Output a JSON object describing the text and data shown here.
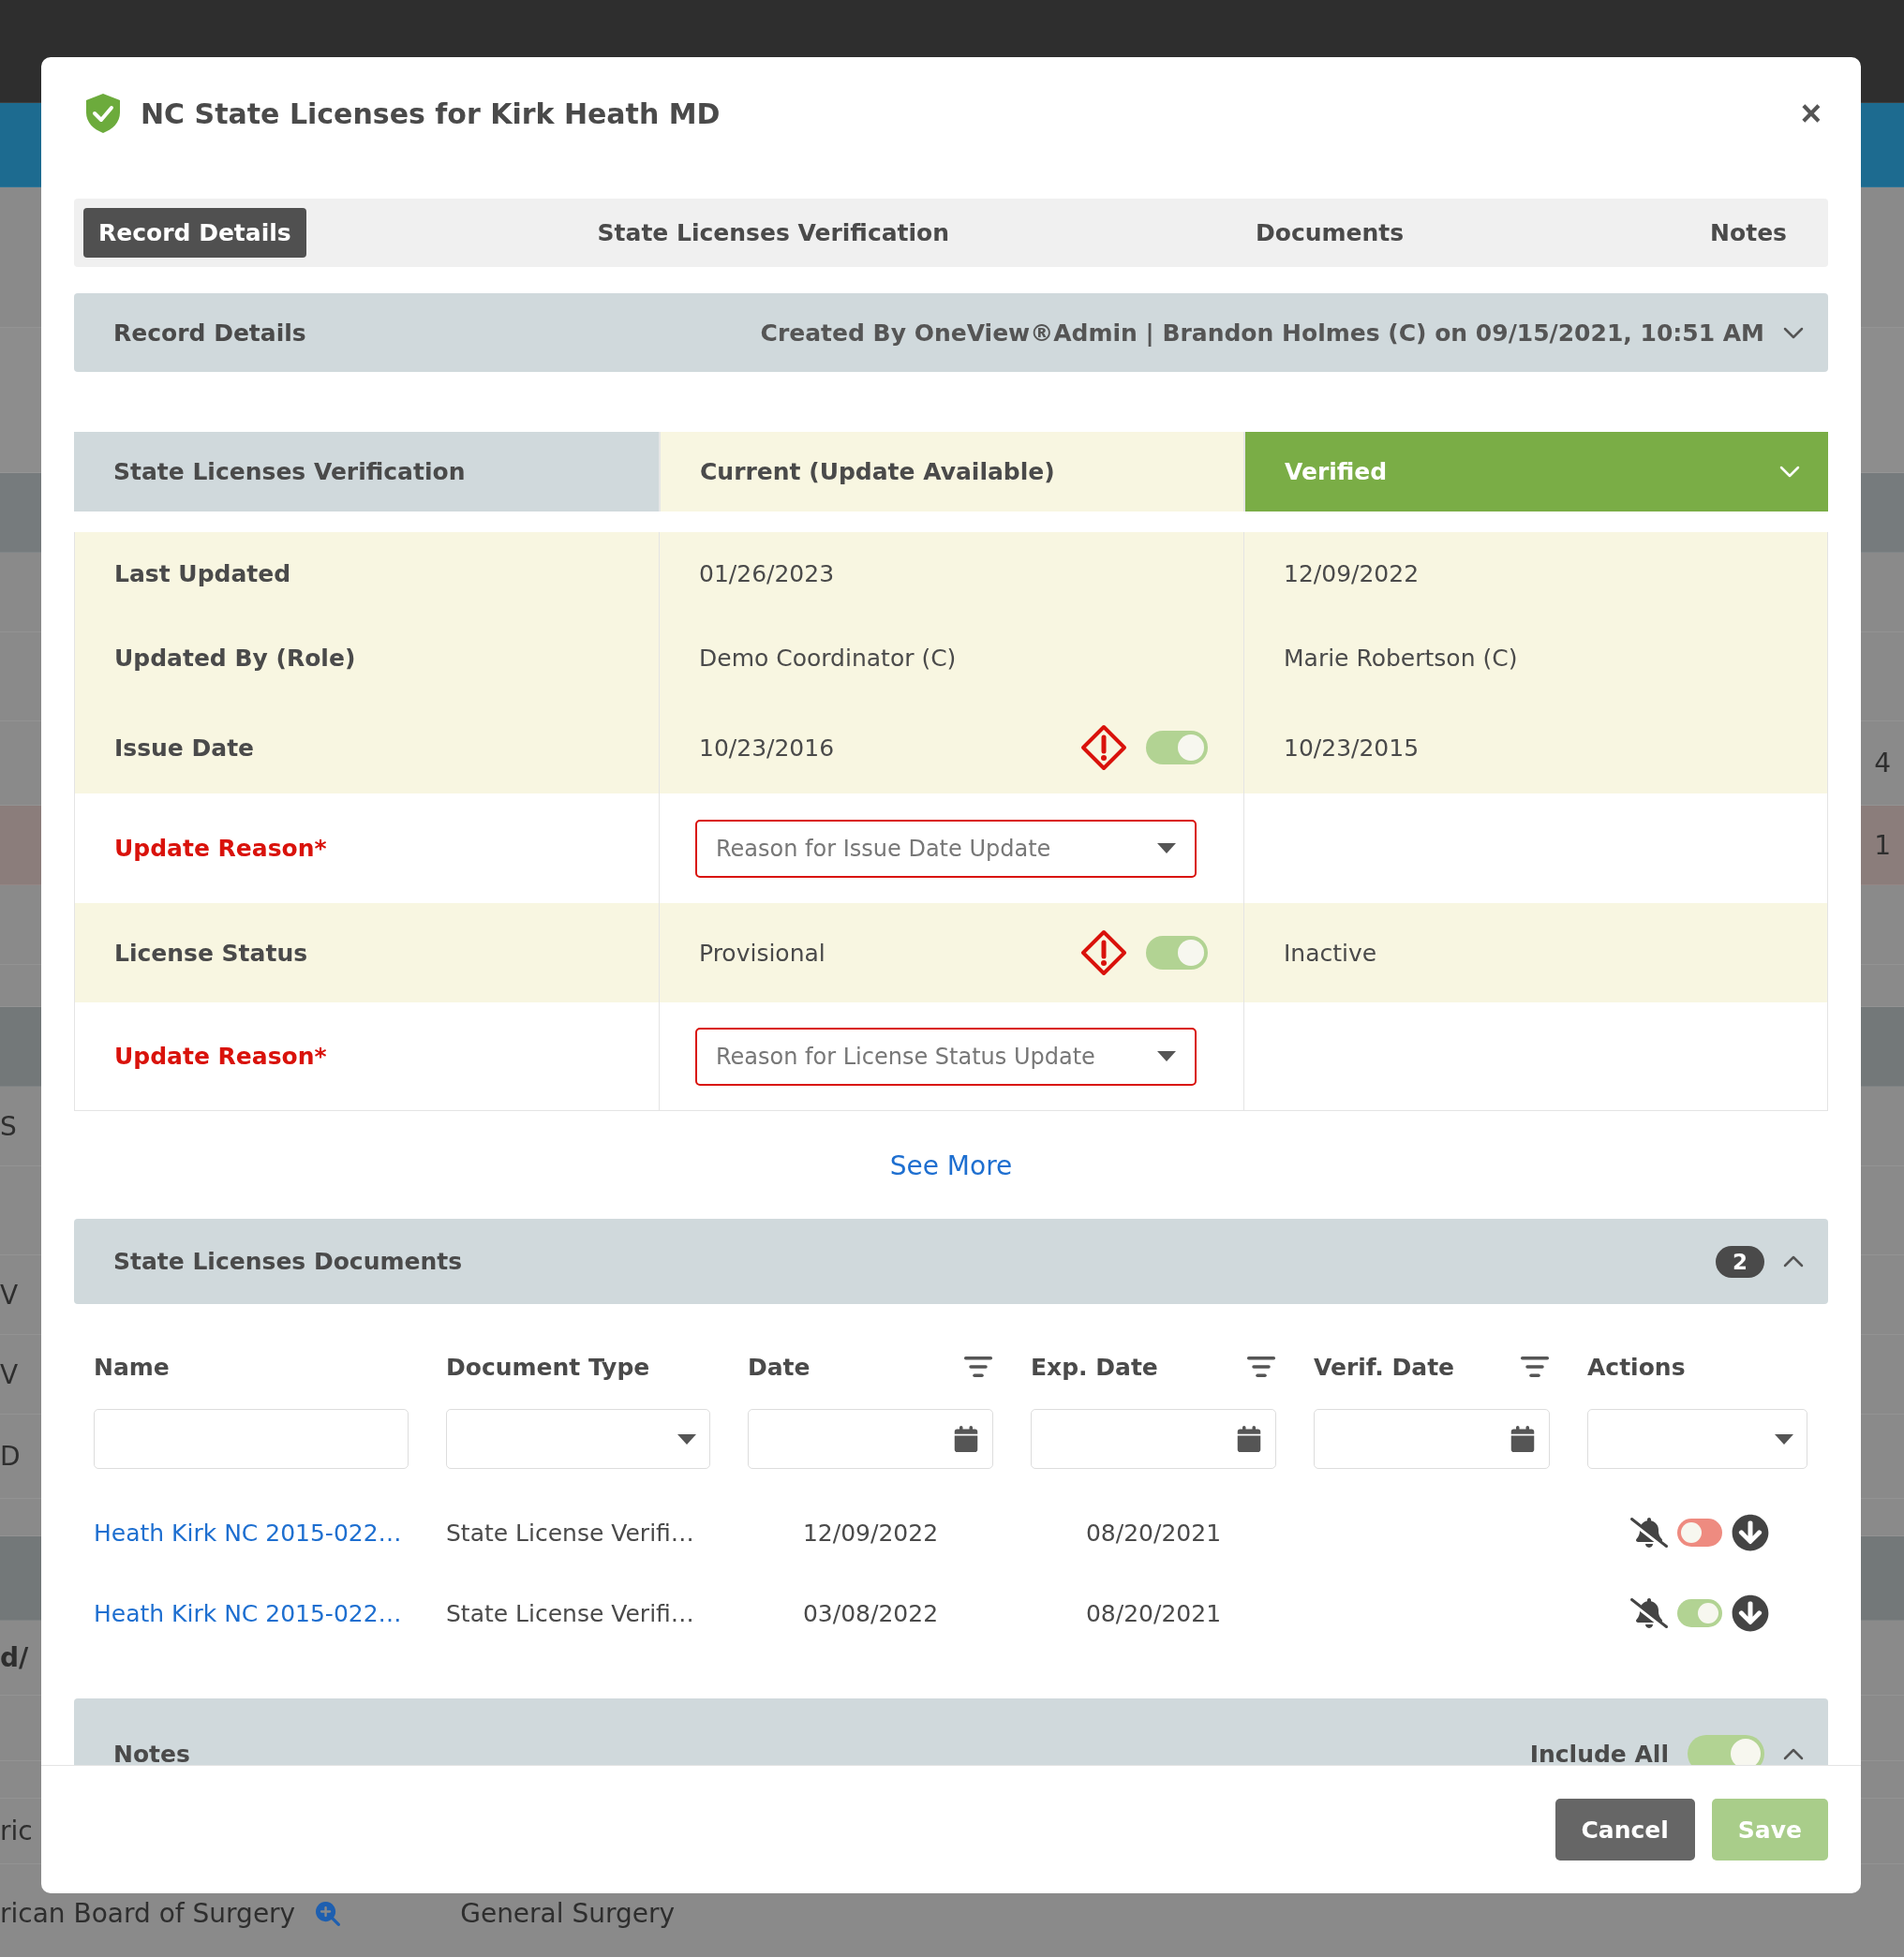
{
  "background_page": {
    "right_fragments": [
      "4",
      "1"
    ],
    "left_fragments": [
      "S",
      "V",
      "V",
      "D",
      "d/",
      "ric"
    ],
    "footer_row": [
      "rican Board of Surgery",
      "General Surgery"
    ]
  },
  "modal": {
    "title": "NC State Licenses for Kirk Heath MD",
    "close": "×"
  },
  "tabs": [
    {
      "label": "Record Details",
      "selected": true
    },
    {
      "label": "State Licenses Verification",
      "selected": false
    },
    {
      "label": "Documents",
      "selected": false
    },
    {
      "label": "Notes",
      "selected": false
    }
  ],
  "record_details": {
    "title": "Record Details",
    "created": "Created By OneView®Admin | Brandon Holmes (C) on 09/15/2021, 10:51 AM"
  },
  "verification": {
    "columns": [
      "State Licenses Verification",
      "Current (Update Available)",
      "Verified"
    ],
    "rows": [
      {
        "kind": "field",
        "label": "Last Updated",
        "current": "01/26/2023",
        "verified": "12/09/2022"
      },
      {
        "kind": "field",
        "label": "Updated By (Role)",
        "current": "Demo Coordinator (C)",
        "verified": "Marie Robertson (C)"
      },
      {
        "kind": "conflict",
        "label": "Issue Date",
        "current": "10/23/2016",
        "verified": "10/23/2015",
        "accepted": true
      },
      {
        "kind": "reason",
        "label": "Update Reason*",
        "placeholder": "Reason for Issue Date Update"
      },
      {
        "kind": "conflict",
        "label": "License Status",
        "current": "Provisional",
        "verified": "Inactive",
        "accepted": true
      },
      {
        "kind": "reason",
        "label": "Update Reason*",
        "placeholder": "Reason for License Status Update"
      }
    ],
    "see_more": "See More"
  },
  "documents": {
    "title": "State Licenses Documents",
    "count": "2",
    "columns": [
      {
        "label": "Name",
        "kind": "text"
      },
      {
        "label": "Document Type",
        "kind": "select"
      },
      {
        "label": "Date",
        "kind": "date"
      },
      {
        "label": "Exp. Date",
        "kind": "date"
      },
      {
        "label": "Verif. Date",
        "kind": "date"
      },
      {
        "label": "Actions",
        "kind": "select"
      }
    ],
    "rows": [
      {
        "name": "Heath Kirk NC 2015-022…",
        "type": "State License Verifi…",
        "date": "12/09/2022",
        "exp_date": "08/20/2021",
        "enabled": false
      },
      {
        "name": "Heath Kirk NC 2015-022…",
        "type": "State License Verifi…",
        "date": "03/08/2022",
        "exp_date": "08/20/2021",
        "enabled": true
      }
    ]
  },
  "notes": {
    "title": "Notes",
    "include_all_label": "Include All",
    "include_all": true
  },
  "buttons": [
    {
      "label": "Cancel",
      "kind": "secondary",
      "disabled": false
    },
    {
      "label": "Save",
      "kind": "primary",
      "disabled": true
    }
  ]
}
